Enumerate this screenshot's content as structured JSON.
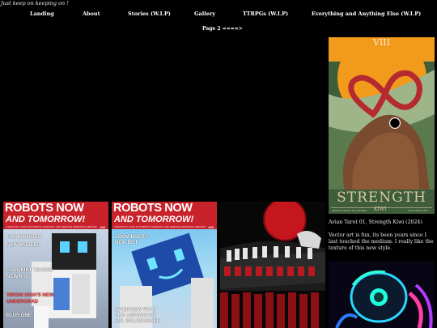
{
  "site": {
    "tagline": "Just keep on keeping on !"
  },
  "nav": {
    "items": [
      "Landing",
      "About",
      "Stories (W.I.P)",
      "Gallery",
      "TTRPGs (W.I.P)",
      "Everything and Anything Else (W.I.P)"
    ]
  },
  "pager": {
    "label": "Page 2 ====>"
  },
  "tarot": {
    "numeral": "VIII",
    "title": "STRENGTH",
    "sub_left": "ARDEA NOVAE ZELANDIAE",
    "sub_center": "KIWI",
    "sub_right": "NEW ZEALAND",
    "caption_title": "Avian Tarot 01, Strength Kiwi (2024)",
    "caption_body": "Vector art is fun, its been years since I last touched the medium. I really like the texture of this new style."
  },
  "magazine1": {
    "title": "ROBOTS NOW",
    "subtitle": "AND TOMORROW!",
    "tagline": "A MONTHLY LOOK AT ROBOTS, GADGETS, AND SERVICE PERSONAL ABOUND",
    "issue": "#42",
    "headlines": [
      "THE BOOSTER",
      "NEW MODELS",
      "CLAY-KIRT TEASES",
      "NEW K-8",
      "VIRGIN HIGH'S NEW",
      "UNDERGRAD",
      "PLUS ONE!"
    ]
  },
  "magazine2": {
    "title": "ROBOTS NOW",
    "subtitle": "AND TOMORROW!",
    "tagline": "A MONTHLY LOOK AT ROBOTS, GADGETS, AND SERVICE PERSONAL ABOUND",
    "issue": "#42",
    "headlines": [
      "ZOOM BOOTS",
      "NEW BOT",
      "INTERVIEW WITH",
      "THE LEGENDARY",
      "E.S. GOLDBURNER"
    ]
  },
  "colors": {
    "bg": "#000000",
    "mag_red": "#c8222a",
    "tarot_green": "#3e5d3a",
    "tarot_orange": "#f29a1c"
  }
}
